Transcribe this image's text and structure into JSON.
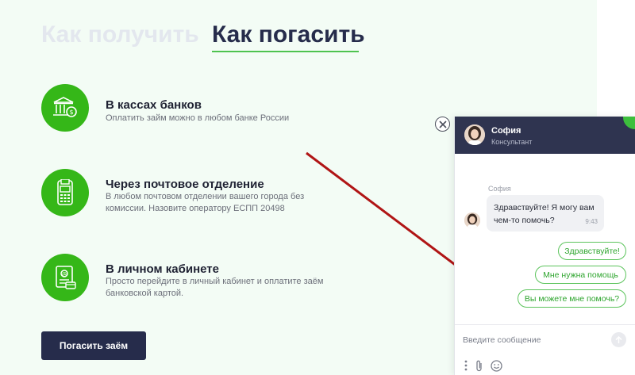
{
  "tabs": {
    "get": "Как получить",
    "pay": "Как погасить"
  },
  "methods": [
    {
      "title": "В кассах банков",
      "desc": "Оплатить займ можно в любом банке России",
      "icon": "bank-icon"
    },
    {
      "title": "Через почтовое отделение",
      "desc": "В любом почтовом отделении вашего города без комиссии. Назовите оператору ЕСПП 20498",
      "icon": "pos-terminal-icon"
    },
    {
      "title": "В личном кабинете",
      "desc": "Просто перейдите в личный кабинет и оплатите заём банковской картой.",
      "icon": "account-icon"
    }
  ],
  "pay_button": "Погасить заём",
  "colors": {
    "accent_green": "#35b718",
    "navy": "#262c4b",
    "arrow_red": "#b01515"
  },
  "chat": {
    "agent_name": "София",
    "agent_role": "Консультант",
    "sender": "София",
    "message": "Здравствуйте! Я могу вам чем-то помочь?",
    "time": "9:43",
    "quick_replies": [
      "Здравствуйте!",
      "Мне нужна помощь",
      "Вы можете мне помочь?"
    ],
    "input_placeholder": "Введите сообщение"
  }
}
